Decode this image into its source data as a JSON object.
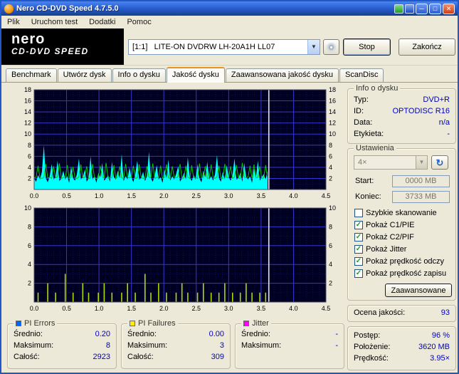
{
  "window": {
    "title": "Nero CD-DVD Speed 4.7.5.0"
  },
  "menu": {
    "items": [
      "Plik",
      "Uruchom test",
      "Dodatki",
      "Pomoc"
    ]
  },
  "header": {
    "logo_line1": "nero",
    "logo_line2": "CD-DVD SPEED",
    "drive_index": "[1:1]",
    "drive_name": "LITE-ON DVDRW LH-20A1H LL07",
    "stop_label": "Stop",
    "exit_label": "Zakończ"
  },
  "tabs": [
    {
      "label": "Benchmark",
      "active": false
    },
    {
      "label": "Utwórz dysk",
      "active": false
    },
    {
      "label": "Info o dysku",
      "active": false
    },
    {
      "label": "Jakość dysku",
      "active": true
    },
    {
      "label": "Zaawansowana jakość dysku",
      "active": false
    },
    {
      "label": "ScanDisc",
      "active": false
    }
  ],
  "disc_info": {
    "title": "Info o dysku",
    "rows": [
      {
        "label": "Typ:",
        "value": "DVD+R"
      },
      {
        "label": "ID:",
        "value": "OPTODISC R16"
      },
      {
        "label": "Data:",
        "value": "n/a"
      },
      {
        "label": "Etykieta:",
        "value": "-"
      }
    ]
  },
  "settings": {
    "title": "Ustawienia",
    "speed_value": "4×",
    "start_label": "Start:",
    "start_value": "0000 MB",
    "end_label": "Koniec:",
    "end_value": "3733 MB",
    "checkboxes": [
      {
        "label": "Szybkie skanowanie",
        "checked": false,
        "glyph": ""
      },
      {
        "label": "Pokaż C1/PIE",
        "checked": true,
        "glyph": "✓"
      },
      {
        "label": "Pokaż C2/PIF",
        "checked": true,
        "glyph": "✓"
      },
      {
        "label": "Pokaż Jitter",
        "checked": true,
        "glyph": "✓"
      },
      {
        "label": "Pokaż prędkość odczy",
        "checked": true,
        "glyph": "✓"
      },
      {
        "label": "Pokaż prędkość zapisu",
        "checked": true,
        "glyph": "✓"
      }
    ],
    "advanced_label": "Zaawansowane"
  },
  "quality": {
    "label": "Ocena jakości:",
    "value": "93"
  },
  "status": {
    "rows": [
      {
        "label": "Postęp:",
        "value": "96 %"
      },
      {
        "label": "Położenie:",
        "value": "3620 MB"
      },
      {
        "label": "Prędkość:",
        "value": "3.95×"
      }
    ]
  },
  "legend_panels": [
    {
      "title": "PI Errors",
      "color": "#0066ff",
      "rows": [
        {
          "label": "Średnio:",
          "value": "0.20"
        },
        {
          "label": "Maksimum:",
          "value": "8"
        },
        {
          "label": "Całość:",
          "value": "2923"
        }
      ]
    },
    {
      "title": "PI Failures",
      "color": "#ffee00",
      "rows": [
        {
          "label": "Średnio:",
          "value": "0.00"
        },
        {
          "label": "Maksimum:",
          "value": "3"
        },
        {
          "label": "Całość:",
          "value": "309"
        }
      ]
    },
    {
      "title": "Jitter",
      "color": "#ff00ff",
      "rows": [
        {
          "label": "Średnio:",
          "value": "-"
        },
        {
          "label": "Maksimum:",
          "value": "-"
        },
        {
          "label": "",
          "value": ""
        }
      ]
    }
  ],
  "chart_data": [
    {
      "type": "area",
      "name": "pi-errors-chart",
      "x_start": 0,
      "x_step": 0.03,
      "xlim": [
        0,
        4.5
      ],
      "ylim": [
        0,
        18
      ],
      "minor_x": 0.1,
      "minor_y": 1,
      "x_ticks": [
        "0.0",
        "0.5",
        "1.0",
        "1.5",
        "2.0",
        "2.5",
        "3.0",
        "3.5",
        "4.0",
        "4.5"
      ],
      "y_ticks": [
        2,
        4,
        6,
        8,
        10,
        12,
        14,
        16,
        18
      ],
      "cursor_x": 3.62,
      "bg": "#000022",
      "grid_minor": "#1c1c74",
      "grid_major": "#3636cc",
      "series": [
        {
          "name": "PI Errors",
          "style": "area",
          "color": "#00ffff",
          "values": [
            2,
            1.4,
            2.6,
            1.8,
            3.2,
            8,
            2,
            1.3,
            2.4,
            4.6,
            1.8,
            2.2,
            5.2,
            1.5,
            2,
            3.4,
            1.8,
            2.4,
            1.2,
            4.2,
            2,
            1.6,
            2.8,
            5.6,
            1.8,
            2.2,
            3.6,
            1.4,
            2,
            6,
            1.8,
            2.4,
            1.2,
            3,
            2.2,
            4.8,
            1.6,
            2,
            2.6,
            1.4,
            5,
            2.2,
            1.8,
            3.4,
            2,
            6.4,
            1.5,
            2.4,
            1.8,
            4,
            2.2,
            1.3,
            2.8,
            5.2,
            1.8,
            2,
            3.2,
            1.5,
            2.4,
            6.8,
            2,
            1.4,
            2.6,
            4.4,
            1.8,
            2.2,
            1.2,
            3.6,
            2,
            5.4,
            1.6,
            2.4,
            1.8,
            2.8,
            4.2,
            1.4,
            2,
            3,
            1.8,
            5.8,
            2.2,
            1.5,
            2.6,
            1.8,
            4.6,
            2,
            1.3,
            3.4,
            2.2,
            5,
            1.8,
            2.4,
            1.6,
            2.8,
            6.2,
            2,
            1.4,
            3.2,
            1.8,
            4.4,
            2.2,
            1.6,
            2.6,
            5.6,
            1.8,
            2,
            3,
            1.4,
            4.8,
            2.2,
            1.8,
            2.4,
            1.2,
            3.8,
            2,
            5.2,
            1.6,
            2.2,
            2.8,
            1.8,
            3.4
          ]
        },
        {
          "name": "Prędkość odczytu",
          "style": "line",
          "color": "#00c800",
          "values": [
            2.1,
            2.2,
            4.3,
            2.1,
            2,
            2.2,
            4.6,
            2.1,
            2.2,
            2,
            4.2,
            2.1,
            2.3,
            4.7,
            2,
            2.2,
            2.1,
            4.4,
            2,
            2.2,
            4.1,
            2.1,
            2,
            2.3,
            4.5,
            2.1,
            2.2,
            4.2,
            2,
            2.1,
            4.6,
            2.2,
            2,
            2.1,
            4.3,
            2.2,
            2.1,
            4.8,
            2,
            2.2,
            2.1,
            4.4,
            2,
            2.2,
            4.2,
            2.1,
            2,
            4.6,
            2.2,
            2.1,
            2.3,
            4.3,
            2,
            2.1,
            4.5,
            2.2,
            2,
            2.1,
            4.2,
            2.2,
            2.1,
            4.7,
            2,
            2.2,
            2.1,
            4.3,
            2,
            2.2,
            4.5,
            2.1,
            2,
            4.2,
            2.2,
            2.1,
            2.3,
            4.6,
            2,
            2.1,
            4.3,
            2.2,
            2,
            4.4,
            2.1,
            2.2,
            2,
            4.7,
            2.1,
            2.2,
            4.2,
            2,
            2.1,
            4.5,
            2.2,
            2,
            2.3,
            4.3,
            2.1,
            2,
            4.6,
            2.2,
            2.1,
            4.2,
            2,
            2.2,
            4.4,
            2.1,
            2,
            4.8,
            2.2,
            2.1,
            2.3,
            4.3,
            2,
            4.5,
            2.1,
            2.2,
            4.2,
            2,
            2.1,
            4.4,
            2.2
          ]
        }
      ]
    },
    {
      "type": "bar",
      "name": "pi-failures-chart",
      "x_start": 0,
      "x_step": 0.03,
      "xlim": [
        0,
        4.5
      ],
      "ylim": [
        0,
        10
      ],
      "minor_x": 0.1,
      "minor_y": 1,
      "x_ticks": [
        "0.0",
        "0.5",
        "1.0",
        "1.5",
        "2.0",
        "2.5",
        "3.0",
        "3.5",
        "4.0",
        "4.5"
      ],
      "y_ticks": [
        2,
        4,
        6,
        8,
        10
      ],
      "cursor_x": 3.62,
      "bg": "#000022",
      "grid_minor": "#1c1c74",
      "grid_major": "#3636cc",
      "series": [
        {
          "name": "PI Failures",
          "style": "bars",
          "color": "#aadd00",
          "values": [
            0,
            0,
            1,
            0,
            0,
            0,
            0,
            2,
            0,
            0,
            0,
            1,
            0,
            0,
            0,
            0,
            3,
            0,
            0,
            0,
            1,
            0,
            0,
            0,
            0,
            2,
            0,
            0,
            1,
            0,
            0,
            0,
            0,
            1,
            0,
            0,
            2,
            0,
            0,
            0,
            1,
            0,
            0,
            0,
            0,
            1,
            0,
            0,
            2,
            0,
            0,
            0,
            1,
            0,
            0,
            0,
            0,
            3,
            0,
            0,
            1,
            0,
            0,
            0,
            2,
            0,
            0,
            0,
            1,
            0,
            0,
            0,
            0,
            1,
            0,
            0,
            2,
            0,
            0,
            1,
            0,
            0,
            0,
            0,
            1,
            0,
            0,
            2,
            0,
            0,
            0,
            1,
            0,
            0,
            0,
            1,
            0,
            0,
            2,
            0,
            0,
            0,
            1,
            0,
            0,
            0,
            1,
            0,
            0,
            2,
            0,
            0,
            1,
            0,
            0,
            0,
            1,
            0,
            0,
            1,
            0
          ]
        }
      ]
    }
  ]
}
